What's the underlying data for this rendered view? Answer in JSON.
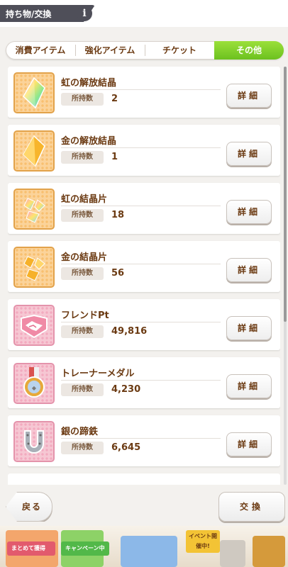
{
  "header": {
    "title": "持ち物/交換",
    "info_label": "i"
  },
  "tabs": [
    {
      "label": "消費アイテム",
      "active": false
    },
    {
      "label": "強化アイテム",
      "active": false
    },
    {
      "label": "チケット",
      "active": false
    },
    {
      "label": "その他",
      "active": true
    }
  ],
  "items": [
    {
      "name": "虹の解放結晶",
      "own_label": "所持数",
      "count": "2",
      "icon": "rainbow-crystal-icon",
      "style": "orange"
    },
    {
      "name": "金の解放結晶",
      "own_label": "所持数",
      "count": "1",
      "icon": "gold-crystal-icon",
      "style": "orange"
    },
    {
      "name": "虹の結晶片",
      "own_label": "所持数",
      "count": "18",
      "icon": "rainbow-shard-icon",
      "style": "orange"
    },
    {
      "name": "金の結晶片",
      "own_label": "所持数",
      "count": "56",
      "icon": "gold-shard-icon",
      "style": "orange"
    },
    {
      "name": "フレンドPt",
      "own_label": "所持数",
      "count": "49,816",
      "icon": "handshake-icon",
      "style": "pink"
    },
    {
      "name": "トレーナーメダル",
      "own_label": "所持数",
      "count": "4,230",
      "icon": "medal-icon",
      "style": "pink"
    },
    {
      "name": "銀の蹄鉄",
      "own_label": "所持数",
      "count": "6,645",
      "icon": "horseshoe-icon",
      "style": "pink"
    }
  ],
  "detail_label": "詳細",
  "bottom": {
    "back_label": "戻る",
    "exchange_label": "交換"
  },
  "footer": {
    "banner1": "まとめて獲得",
    "banner2": "キャンペーン中",
    "banner3": "イベント開催中!"
  },
  "colors": {
    "accent_green": "#6cc11f",
    "text_brown": "#6b3a12",
    "header_plate": "#4f4f59"
  }
}
